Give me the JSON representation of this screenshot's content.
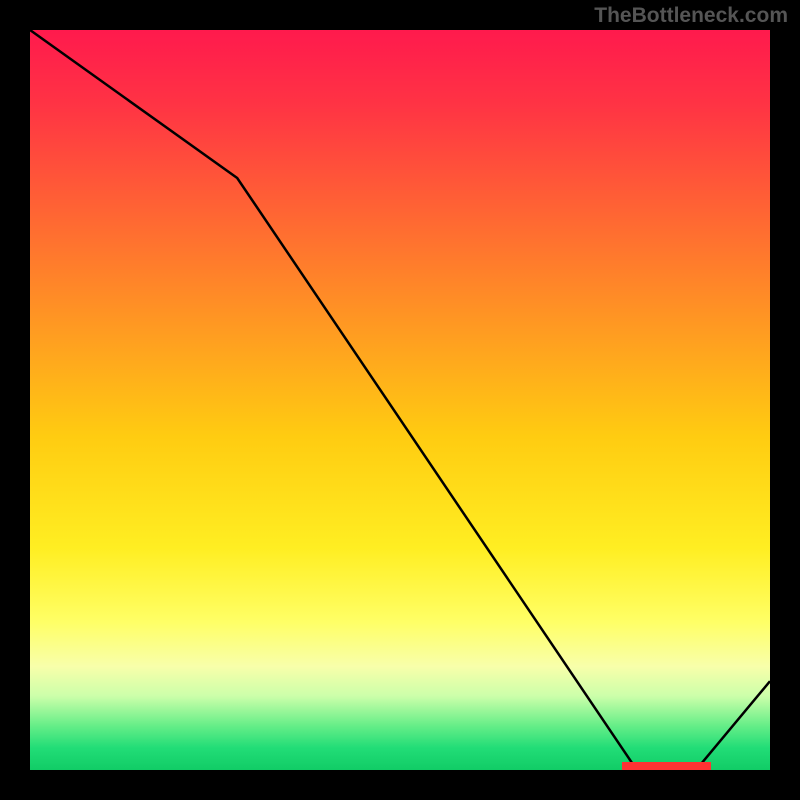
{
  "watermark": "TheBottleneck.com",
  "chart_data": {
    "type": "line",
    "title": "",
    "xlabel": "",
    "ylabel": "",
    "x": [
      0,
      0.28,
      0.82,
      0.9,
      1.0
    ],
    "values": [
      1.0,
      0.8,
      0.0,
      0.0,
      0.12
    ],
    "xlim": [
      0,
      1
    ],
    "ylim": [
      0,
      1
    ],
    "optimal_range": [
      0.8,
      0.92
    ],
    "background_gradient": {
      "top": "#ff1a4d",
      "mid": "#ffee22",
      "bottom": "#11cc66"
    }
  }
}
